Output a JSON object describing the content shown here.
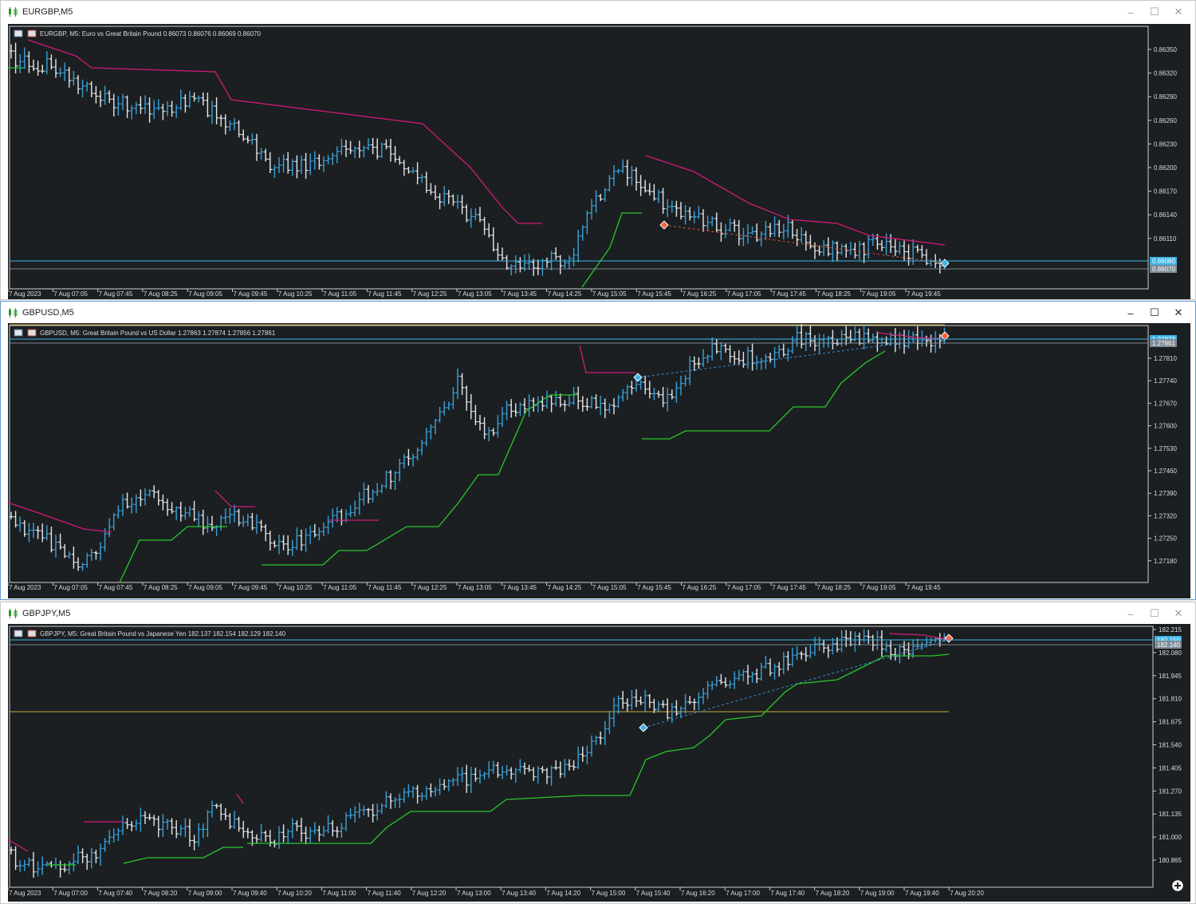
{
  "colors": {
    "bg": "#1b1f22",
    "bull": "#3aa0d8",
    "bear": "#e6e6e6",
    "upper_stop": "#d01a78",
    "lower_stop": "#28c828",
    "price_line": "#3cb4e6",
    "level_line": "#c8a838",
    "dashed_up": "#3c8ccc",
    "dashed_down": "#d05030"
  },
  "windows": [
    {
      "id": "eurgbp",
      "title": "EURGBP,M5",
      "info": "EURGBP, M5:  Euro vs Great Britain Pound   0.86073 0.86076 0.86069 0.86070",
      "price_tag_current": "0.86080",
      "price_tag_bid": "0.86070",
      "yticks": [
        "0.86350",
        "0.86320",
        "0.86290",
        "0.86260",
        "0.86230",
        "0.86200",
        "0.86170",
        "0.86140",
        "0.86110"
      ],
      "xticks": [
        "7 Aug 2023",
        "7 Aug 07:05",
        "7 Aug 07:45",
        "7 Aug 08:25",
        "7 Aug 09:05",
        "7 Aug 09:45",
        "7 Aug 10:25",
        "7 Aug 11:05",
        "7 Aug 11:45",
        "7 Aug 12:25",
        "7 Aug 13:05",
        "7 Aug 13:45",
        "7 Aug 14:25",
        "7 Aug 15:05",
        "7 Aug 15:45",
        "7 Aug 16:25",
        "7 Aug 17:05",
        "7 Aug 17:45",
        "7 Aug 18:25",
        "7 Aug 19:05",
        "7 Aug 19:45"
      ],
      "window_buttons": {
        "minimize": "–",
        "maximize": "☐",
        "close": "✕"
      }
    },
    {
      "id": "gbpusd",
      "title": "GBPUSD,M5",
      "info": "GBPUSD, M5:  Great Britain Pound vs US Dollar   1.27863 1.27874 1.27856 1.27861",
      "price_tag_current": "1.27873",
      "price_tag_bid": "1.27861",
      "yticks": [
        "1.27810",
        "1.27740",
        "1.27670",
        "1.27600",
        "1.27530",
        "1.27460",
        "1.27390",
        "1.27320",
        "1.27250",
        "1.27180"
      ],
      "xticks": [
        "7 Aug 2023",
        "7 Aug 07:05",
        "7 Aug 07:45",
        "7 Aug 08:25",
        "7 Aug 09:05",
        "7 Aug 09:45",
        "7 Aug 10:25",
        "7 Aug 11:05",
        "7 Aug 11:45",
        "7 Aug 12:25",
        "7 Aug 13:05",
        "7 Aug 13:45",
        "7 Aug 14:25",
        "7 Aug 15:05",
        "7 Aug 15:45",
        "7 Aug 16:25",
        "7 Aug 17:05",
        "7 Aug 17:45",
        "7 Aug 18:25",
        "7 Aug 19:05",
        "7 Aug 19:45"
      ],
      "window_buttons": {
        "minimize": "–",
        "maximize": "☐",
        "close": "✕"
      }
    },
    {
      "id": "gbpjpy",
      "title": "GBPJPY,M5",
      "info": "GBPJPY, M5:  Great Britain Pound vs Japanese Yen   182.137 182.154 182.129 182.140",
      "price_tag_current": "182.150",
      "price_tag_bid": "182.140",
      "yticks": [
        "182.215",
        "182.080",
        "181.945",
        "181.810",
        "181.675",
        "181.540",
        "181.405",
        "181.270",
        "181.135",
        "181.000",
        "180.865"
      ],
      "xticks": [
        "7 Aug 2023",
        "7 Aug 07:00",
        "7 Aug 07:40",
        "7 Aug 08:20",
        "7 Aug 09:00",
        "7 Aug 09:40",
        "7 Aug 10:20",
        "7 Aug 11:00",
        "7 Aug 11:40",
        "7 Aug 12:20",
        "7 Aug 13:00",
        "7 Aug 13:40",
        "7 Aug 14:20",
        "7 Aug 15:00",
        "7 Aug 15:40",
        "7 Aug 16:20",
        "7 Aug 17:00",
        "7 Aug 17:40",
        "7 Aug 18:20",
        "7 Aug 19:00",
        "7 Aug 19:40",
        "7 Aug 20:20"
      ],
      "window_buttons": {
        "minimize": "–",
        "maximize": "☐",
        "close": "✕"
      }
    }
  ]
}
